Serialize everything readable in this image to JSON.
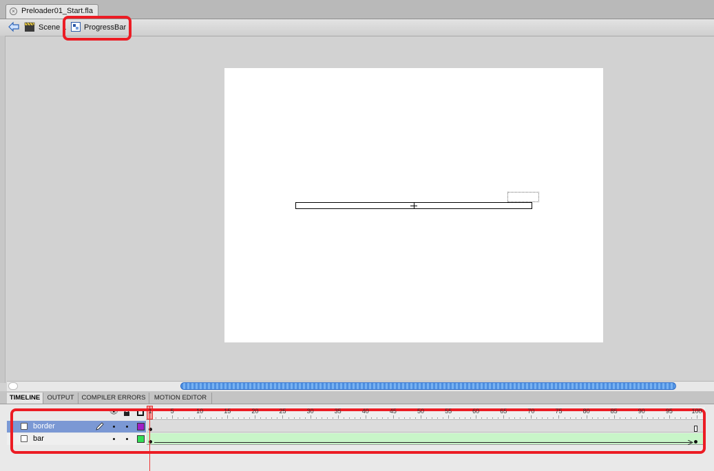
{
  "document_tab": {
    "title": "Preloader01_Start.fla",
    "close_glyph": "×"
  },
  "breadcrumb": {
    "scene": "Scene 1",
    "symbol": "ProgressBar"
  },
  "panel_tabs": [
    {
      "label": "TIMELINE",
      "active": true
    },
    {
      "label": "OUTPUT",
      "active": false
    },
    {
      "label": "COMPILER ERRORS",
      "active": false
    },
    {
      "label": "MOTION EDITOR",
      "active": false
    }
  ],
  "timeline": {
    "ruler_labels": [
      "1",
      "5",
      "10",
      "15",
      "20",
      "25",
      "30",
      "35",
      "40",
      "45",
      "50",
      "55",
      "60",
      "65",
      "70",
      "75",
      "80",
      "85",
      "90",
      "95",
      "100"
    ],
    "current_frame": 1,
    "total_frames": 100,
    "layers": [
      {
        "name": "border",
        "selected": true,
        "color": "#a020c8"
      },
      {
        "name": "bar",
        "selected": false,
        "color": "#33dd55"
      }
    ]
  },
  "colors": {
    "highlight": "#ec1c24",
    "selected_layer": "#7b98d4",
    "tween_fill": "#c8f5c8",
    "scroll_thumb": "#4e8fe0"
  },
  "icons": [
    "close-icon",
    "back-arrow-icon",
    "scene-icon",
    "movieclip-symbol-icon",
    "eye-icon",
    "lock-icon",
    "outline-icon",
    "pencil-icon",
    "layer-icon"
  ]
}
